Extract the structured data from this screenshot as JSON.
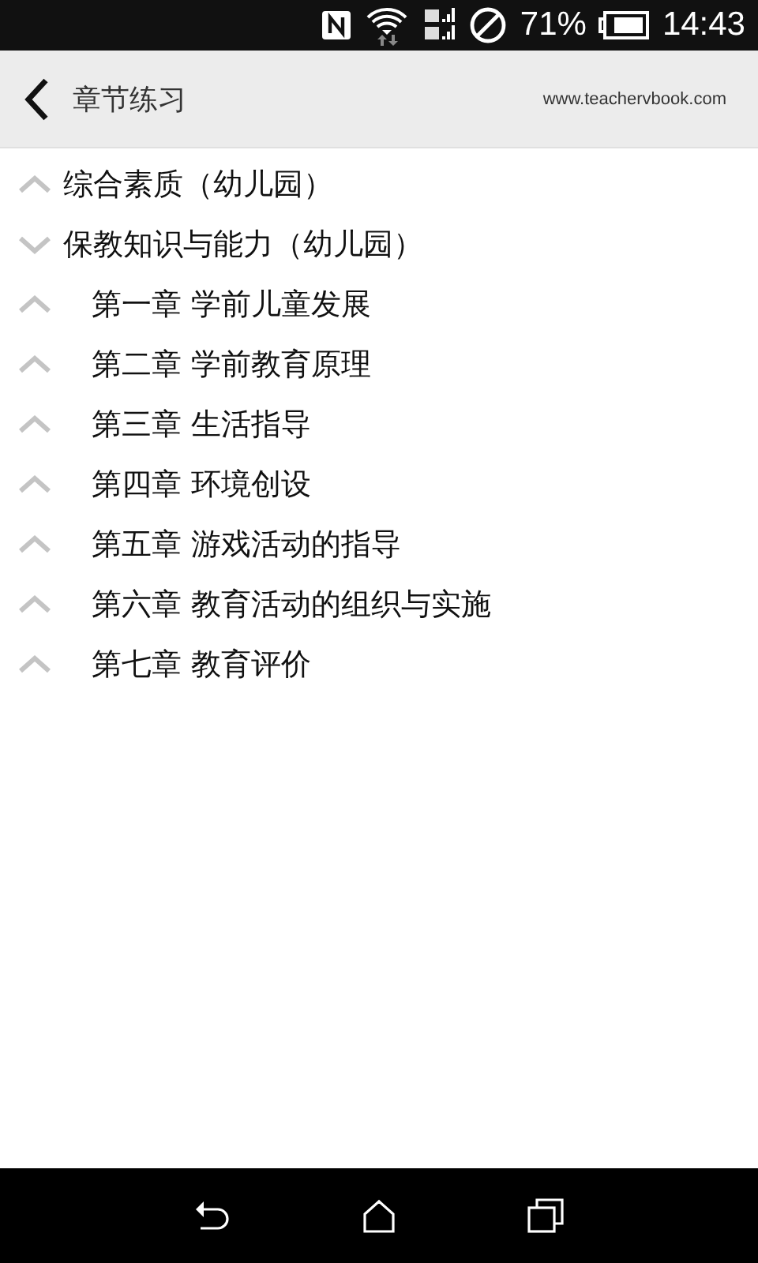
{
  "status_bar": {
    "battery": "71%",
    "time": "14:43"
  },
  "header": {
    "title": "章节练习",
    "website": "www.teachervbook.com"
  },
  "tree": [
    {
      "label": "综合素质（幼儿园）",
      "expanded": false
    },
    {
      "label": "保教知识与能力（幼儿园）",
      "expanded": true,
      "children": [
        {
          "label": "第一章 学前儿童发展",
          "expanded": false
        },
        {
          "label": "第二章 学前教育原理",
          "expanded": false
        },
        {
          "label": "第三章 生活指导",
          "expanded": false
        },
        {
          "label": "第四章 环境创设",
          "expanded": false
        },
        {
          "label": "第五章 游戏活动的指导",
          "expanded": false
        },
        {
          "label": "第六章 教育活动的组织与实施",
          "expanded": false
        },
        {
          "label": "第七章 教育评价",
          "expanded": false
        }
      ]
    }
  ]
}
